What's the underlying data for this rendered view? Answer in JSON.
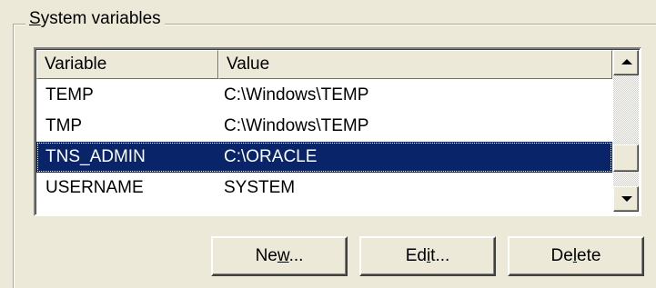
{
  "group": {
    "legend_accel": "S",
    "legend_rest": "ystem variables"
  },
  "list": {
    "columns": [
      "Variable",
      "Value"
    ],
    "rows": [
      {
        "variable": "TEMP",
        "value": "C:\\Windows\\TEMP",
        "selected": false
      },
      {
        "variable": "TMP",
        "value": "C:\\Windows\\TEMP",
        "selected": false
      },
      {
        "variable": "TNS_ADMIN",
        "value": "C:\\ORACLE",
        "selected": true
      },
      {
        "variable": "USERNAME",
        "value": "SYSTEM",
        "selected": false
      }
    ],
    "selected_bg": "#0a246a"
  },
  "scrollbar": {
    "up_icon": "arrow-up",
    "down_icon": "arrow-down"
  },
  "buttons": {
    "new": {
      "pre": "Ne",
      "accel": "w",
      "post": "..."
    },
    "edit": {
      "pre": "Ed",
      "accel": "i",
      "post": "t..."
    },
    "delete": {
      "pre": "De",
      "accel": "l",
      "post": "ete"
    }
  }
}
